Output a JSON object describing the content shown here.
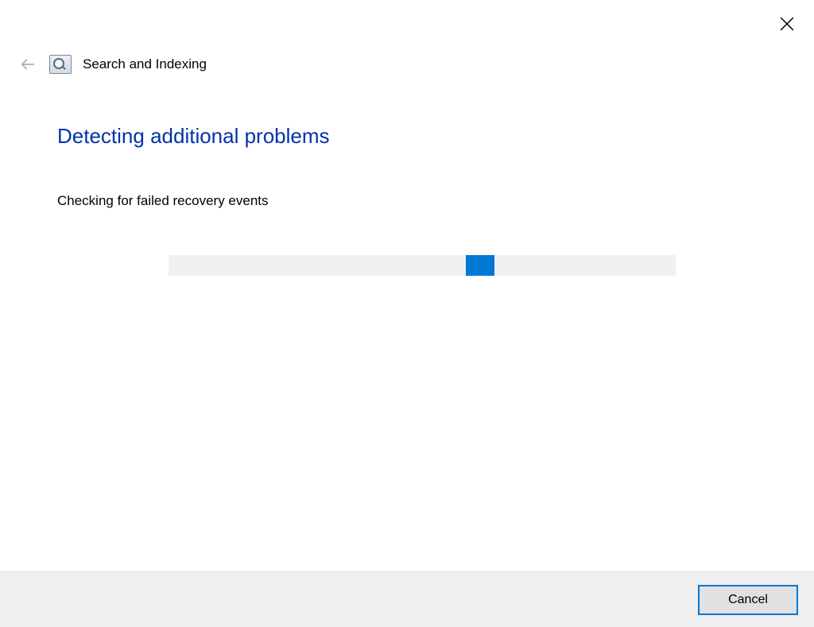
{
  "header": {
    "title": "Search and Indexing"
  },
  "content": {
    "heading": "Detecting additional problems",
    "status": "Checking for failed recovery events"
  },
  "progress": {
    "indeterminate": true,
    "chunk_position_percent": 59
  },
  "footer": {
    "cancel_label": "Cancel"
  },
  "colors": {
    "heading": "#0033aa",
    "accent": "#0078d4",
    "track": "#f0f0f0",
    "footer_bg": "#f0f0f0"
  }
}
